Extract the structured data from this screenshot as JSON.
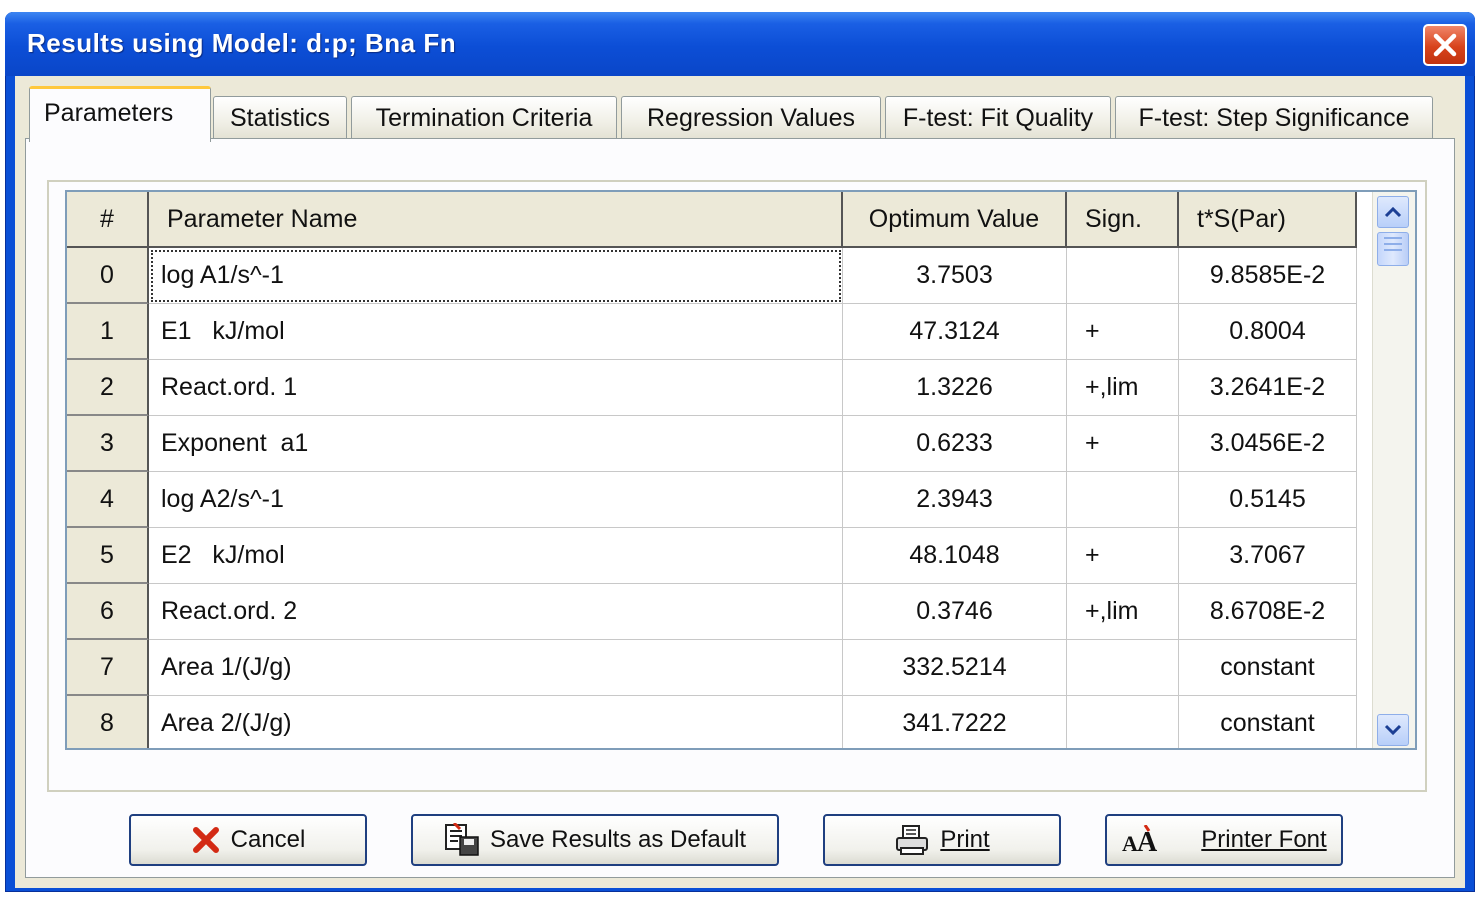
{
  "window": {
    "title": "Results using Model: d:p;  Bna Fn",
    "colors": {
      "titlebar": "#0c4ed6",
      "client": "#ece9d8",
      "close": "#d8431c",
      "active_tab_accent": "#ffc83c"
    }
  },
  "tabs": [
    {
      "label": "Parameters",
      "active": true
    },
    {
      "label": "Statistics",
      "active": false
    },
    {
      "label": "Termination Criteria",
      "active": false
    },
    {
      "label": "Regression Values",
      "active": false
    },
    {
      "label": "F-test: Fit Quality",
      "active": false
    },
    {
      "label": "F-test: Step Significance",
      "active": false
    }
  ],
  "table": {
    "headers": {
      "index": "#",
      "name": "Parameter Name",
      "value": "Optimum Value",
      "sign": "Sign.",
      "tsp": "t*S(Par)"
    },
    "rows": [
      {
        "index": "0",
        "name": "log A1/s^-1",
        "value": "3.7503",
        "sign": "",
        "tsp": "9.8585E-2"
      },
      {
        "index": "1",
        "name": "E1   kJ/mol",
        "value": "47.3124",
        "sign": "+",
        "tsp": "0.8004"
      },
      {
        "index": "2",
        "name": "React.ord. 1",
        "value": "1.3226",
        "sign": "+,lim",
        "tsp": "3.2641E-2"
      },
      {
        "index": "3",
        "name": "Exponent  a1",
        "value": "0.6233",
        "sign": "+",
        "tsp": "3.0456E-2"
      },
      {
        "index": "4",
        "name": "log A2/s^-1",
        "value": "2.3943",
        "sign": "",
        "tsp": "0.5145"
      },
      {
        "index": "5",
        "name": "E2   kJ/mol",
        "value": "48.1048",
        "sign": "+",
        "tsp": "3.7067"
      },
      {
        "index": "6",
        "name": "React.ord. 2",
        "value": "0.3746",
        "sign": "+,lim",
        "tsp": "8.6708E-2"
      },
      {
        "index": "7",
        "name": "Area 1/(J/g)",
        "value": "332.5214",
        "sign": "",
        "tsp": "constant"
      },
      {
        "index": "8",
        "name": "Area 2/(J/g)",
        "value": "341.7222",
        "sign": "",
        "tsp": "constant"
      }
    ]
  },
  "buttons": {
    "cancel": {
      "label": "Cancel",
      "icon": "red-x-icon"
    },
    "save_default": {
      "label": "Save Results as Default",
      "icon": "save-document-icon"
    },
    "print": {
      "label": "Print",
      "icon": "printer-icon"
    },
    "printer_font": {
      "label": "Printer Font",
      "icon": "font-aa-icon"
    }
  }
}
